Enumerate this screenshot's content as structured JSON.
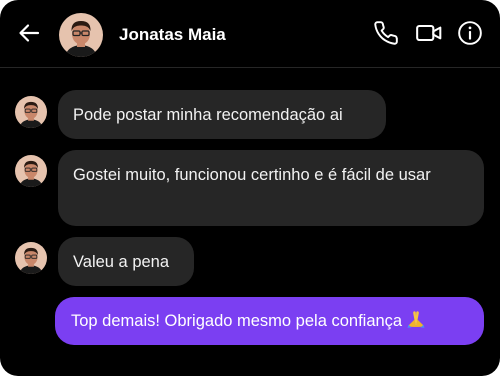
{
  "header": {
    "back_icon": "arrow-left-icon",
    "contact_name": "Jonatas Maia",
    "call_icon": "phone-icon",
    "video_icon": "video-camera-icon",
    "info_icon": "info-icon"
  },
  "messages": [
    {
      "direction": "received",
      "text": "Pode postar minha recomendação ai"
    },
    {
      "direction": "received",
      "text": "Gostei muito, funcionou certinho e é fácil de usar"
    },
    {
      "direction": "received",
      "text": "Valeu a pena"
    },
    {
      "direction": "sent",
      "text": "Top demais! Obrigado mesmo pela confiança",
      "emoji": "folded-hands-emoji"
    }
  ],
  "colors": {
    "background": "#000000",
    "received_bubble": "#262626",
    "sent_bubble": "#7b3ff2",
    "text": "#ffffff"
  }
}
